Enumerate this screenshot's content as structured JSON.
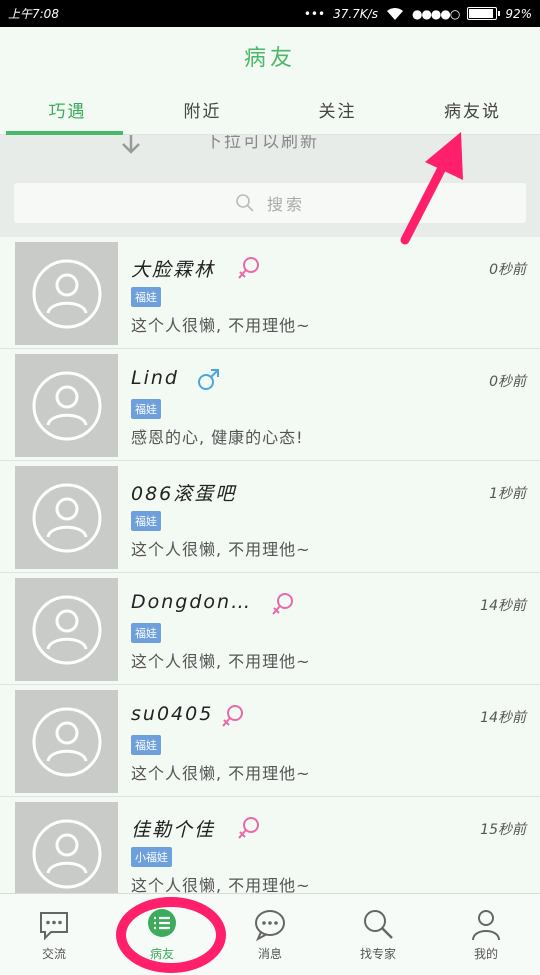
{
  "status_bar": {
    "time": "上午7:08",
    "network_speed": "37.7K/s",
    "signal_dots": "●●●●○",
    "battery": "92%",
    "battery_level": 0.92
  },
  "header": {
    "title": "病友"
  },
  "tabs": [
    {
      "label": "巧遇",
      "active": true
    },
    {
      "label": "附近",
      "active": false
    },
    {
      "label": "关注",
      "active": false
    },
    {
      "label": "病友说",
      "active": false
    }
  ],
  "pull_refresh": {
    "text": "下拉可以刷新"
  },
  "search": {
    "placeholder": "搜索"
  },
  "users": [
    {
      "name": "大脸霖林",
      "gender": "female",
      "badge": "福娃",
      "status": "这个人很懒, 不用理他~",
      "time": "0秒前"
    },
    {
      "name": "Lind",
      "gender": "male",
      "badge": "福娃",
      "status": "感恩的心, 健康的心态!",
      "time": "0秒前"
    },
    {
      "name": "086滚蛋吧",
      "gender": "none",
      "badge": "福娃",
      "status": "这个人很懒, 不用理他~",
      "time": "1秒前"
    },
    {
      "name": "Dongdon…",
      "gender": "female",
      "badge": "福娃",
      "status": "这个人很懒, 不用理他~",
      "time": "14秒前"
    },
    {
      "name": "su0405",
      "gender": "female",
      "badge": "福娃",
      "status": "这个人很懒, 不用理他~",
      "time": "14秒前"
    },
    {
      "name": "佳勒个佳",
      "gender": "female",
      "badge": "小福娃",
      "status": "这个人很懒, 不用理他~",
      "time": "15秒前"
    }
  ],
  "bottom_nav": [
    {
      "label": "交流",
      "icon": "chat-bubble-icon",
      "active": false
    },
    {
      "label": "病友",
      "icon": "list-icon",
      "active": true
    },
    {
      "label": "消息",
      "icon": "message-icon",
      "active": false
    },
    {
      "label": "找专家",
      "icon": "search-icon",
      "active": false
    },
    {
      "label": "我的",
      "icon": "person-icon",
      "active": false
    }
  ],
  "colors": {
    "accent_green": "#4cb868",
    "badge_blue": "#6ea0db",
    "female_pink": "#e86aa8",
    "male_blue": "#4aa6e0",
    "annotation_red": "#ff1f6b"
  }
}
